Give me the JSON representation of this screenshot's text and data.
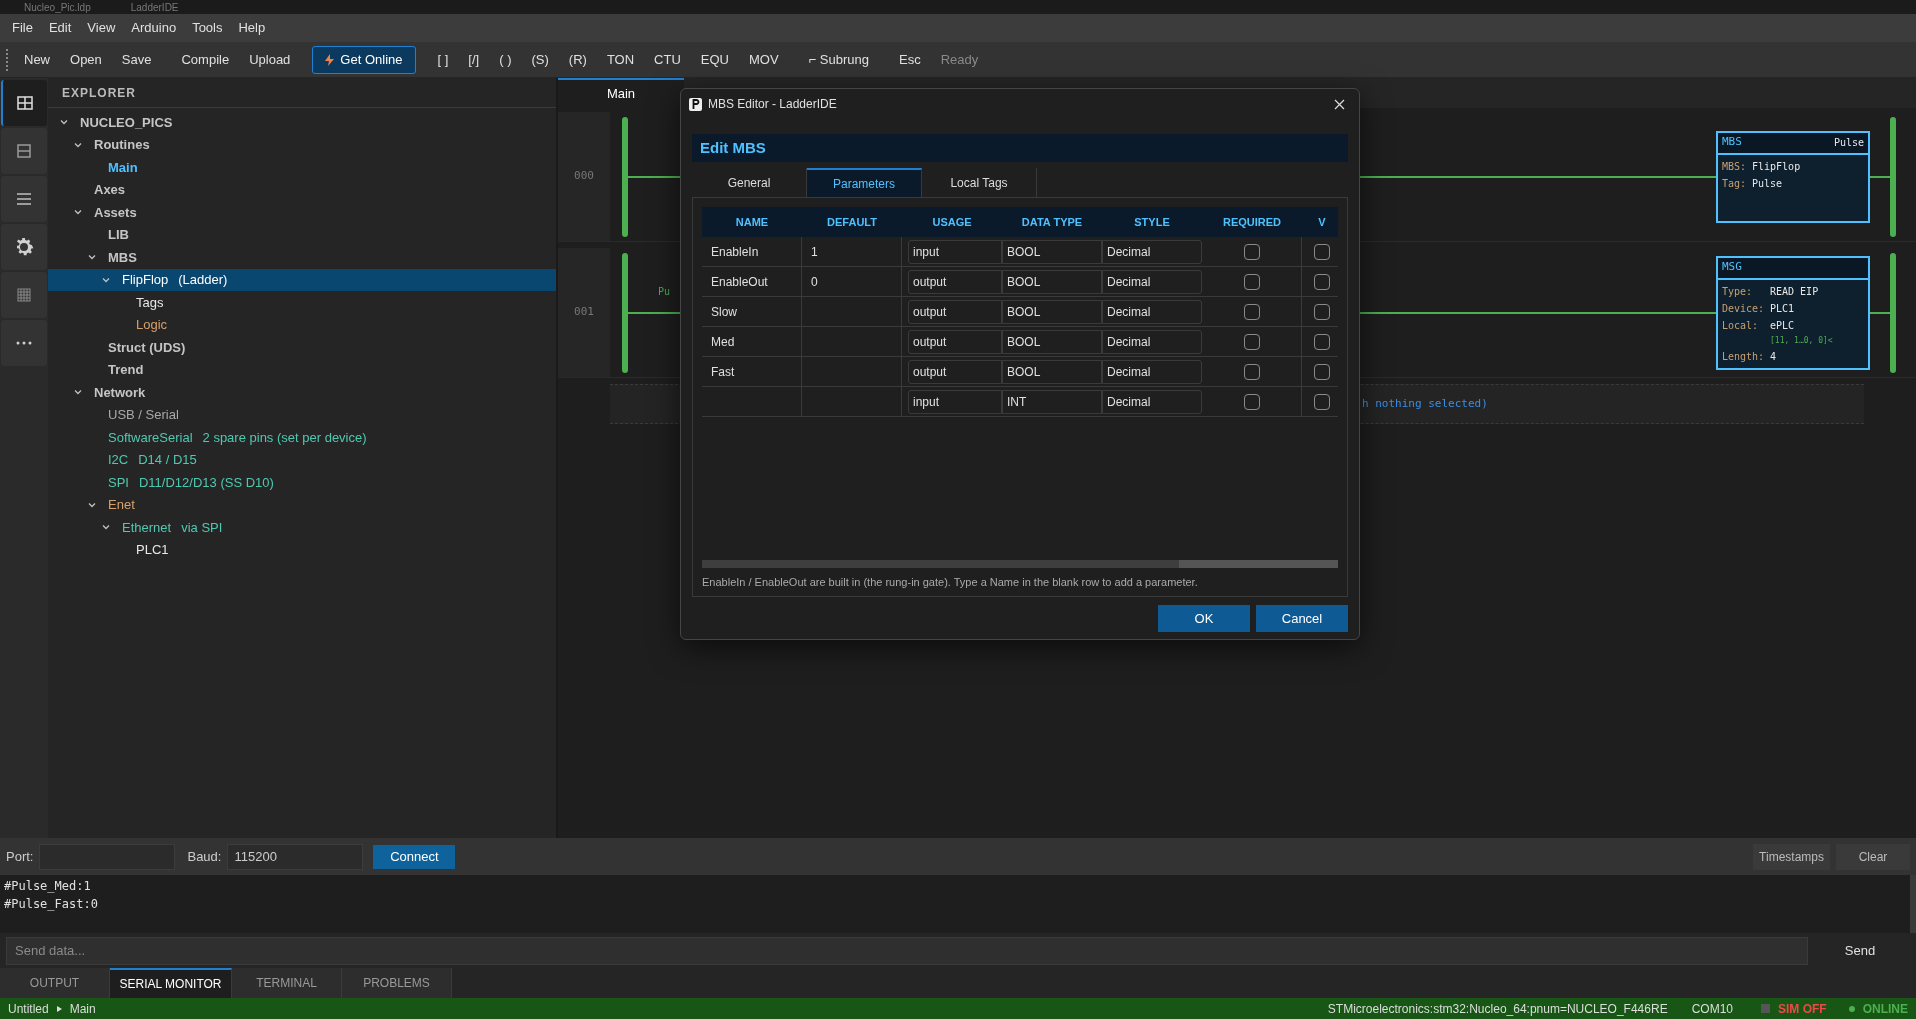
{
  "window": {
    "title": "Nucleo_Pic.ldp",
    "app": "LadderIDE"
  },
  "menu": [
    "File",
    "Edit",
    "View",
    "Arduino",
    "Tools",
    "Help"
  ],
  "toolbar": [
    [
      {
        "label": "New",
        "kind": "button"
      },
      {
        "label": "Open",
        "kind": "button"
      },
      {
        "label": "Save",
        "kind": "button"
      }
    ],
    [
      {
        "label": "Compile",
        "kind": "button"
      },
      {
        "label": "Upload",
        "kind": "button"
      }
    ],
    [
      {
        "label": "Get Online",
        "kind": "primary"
      }
    ],
    [
      {
        "label": "[ ]",
        "kind": "button"
      },
      {
        "label": "[/]",
        "kind": "button"
      },
      {
        "label": "( )",
        "kind": "button"
      },
      {
        "label": "(S)",
        "kind": "button"
      },
      {
        "label": "(R)",
        "kind": "button"
      },
      {
        "label": "TON",
        "kind": "button"
      },
      {
        "label": "CTU",
        "kind": "button"
      },
      {
        "label": "EQU",
        "kind": "button"
      },
      {
        "label": "MOV",
        "kind": "button"
      }
    ],
    [
      {
        "label": "⌐ Subrung",
        "kind": "button"
      }
    ],
    [
      {
        "label": "Esc",
        "kind": "button"
      },
      {
        "label": "Ready",
        "kind": "status"
      }
    ]
  ],
  "activity_bar": [
    {
      "kind": "explorer",
      "selected": true
    },
    {
      "kind": "panel",
      "selected": false
    },
    {
      "kind": "list",
      "selected": false
    },
    {
      "kind": "settings",
      "selected": false
    },
    {
      "kind": "table",
      "selected": false
    },
    {
      "kind": "more",
      "selected": false
    }
  ],
  "explorer": {
    "title": "EXPLORER",
    "tree": [
      {
        "label": "NUCLEO_PICS",
        "kind": "group",
        "color": "#c5c5c5",
        "selected": false,
        "expanded": true,
        "children": [
          {
            "label": "Routines",
            "kind": "group",
            "color": "#c5c5c5",
            "selected": false,
            "expanded": true,
            "children": [
              {
                "label": "Main",
                "kind": "group",
                "color": "#4fc1ff",
                "selected": false
              }
            ]
          },
          {
            "label": "Axes",
            "kind": "group",
            "color": "#c5c5c5",
            "selected": false
          },
          {
            "label": "Assets",
            "kind": "group",
            "color": "#c5c5c5",
            "selected": false,
            "expanded": true,
            "children": [
              {
                "label": "LIB",
                "kind": "group",
                "color": "#c5c5c5",
                "selected": false
              },
              {
                "label": "MBS",
                "kind": "group",
                "color": "#c5c5c5",
                "selected": false,
                "expanded": true,
                "children": [
                  {
                    "label": "FlipFlop",
                    "detail": "(Ladder)",
                    "kind": "item",
                    "selected": true,
                    "expanded": true,
                    "children": [
                      {
                        "label": "Tags",
                        "kind": "item",
                        "color": "#e8e8e8",
                        "selected": false
                      },
                      {
                        "label": "Logic",
                        "kind": "item",
                        "color": "#d7a06a",
                        "selected": false
                      }
                    ]
                  }
                ]
              },
              {
                "label": "Struct (UDS)",
                "kind": "group",
                "color": "#c5c5c5",
                "selected": false
              },
              {
                "label": "Trend",
                "kind": "group",
                "color": "#c5c5c5",
                "selected": false
              }
            ]
          },
          {
            "label": "Network",
            "kind": "group",
            "color": "#c5c5c5",
            "selected": false,
            "expanded": true,
            "children": [
              {
                "label": "USB / Serial",
                "kind": "item",
                "color": "#a8a8a8",
                "selected": false
              },
              {
                "label": "SoftwareSerial",
                "detail": "2 spare pins (set per device)",
                "kind": "item",
                "color": "#4ec9b0",
                "selected": false
              },
              {
                "label": "I2C",
                "detail": "D14 / D15",
                "kind": "item",
                "color": "#4ec9b0",
                "selected": false
              },
              {
                "label": "SPI",
                "detail": "D11/D12/D13 (SS D10)",
                "kind": "item",
                "color": "#4ec9b0",
                "selected": false
              },
              {
                "label": "Enet",
                "kind": "item",
                "color": "#d7a06a",
                "selected": false,
                "expanded": true,
                "children": [
                  {
                    "label": "Ethernet",
                    "detail": "via SPI",
                    "kind": "item",
                    "color": "#4ec9b0",
                    "selected": false,
                    "expanded": true,
                    "children": [
                      {
                        "label": "PLC1",
                        "kind": "item",
                        "color": "#e8e8e8",
                        "selected": false
                      }
                    ]
                  }
                ]
              }
            ]
          }
        ]
      }
    ]
  },
  "editor": {
    "tabs": [
      {
        "label": "Main",
        "selected": true
      }
    ],
    "rungs": [
      {
        "number": "000",
        "block": {
          "name": "MBS",
          "tag": "Pulse",
          "lines": [
            {
              "label": "MBS:",
              "value": "FlipFlop"
            },
            {
              "label": "Tag:",
              "value": "Pulse"
            }
          ]
        }
      },
      {
        "number": "001",
        "contact_label": "Pu",
        "block": {
          "name": "MSG",
          "lines": [
            {
              "label": "Type:",
              "value": "READ EIP"
            },
            {
              "label": "Device:",
              "value": "PLC1"
            },
            {
              "label": "Local:",
              "value": "ePLC"
            },
            {
              "value": "[11, 1…0, 0]<",
              "kind": "note"
            },
            {
              "label": "Length:",
              "value": "4"
            }
          ]
        }
      }
    ],
    "drop_hint": "h nothing selected)"
  },
  "dialog": {
    "title": "MBS Editor - LadderIDE",
    "heading": "Edit MBS",
    "tabs": [
      {
        "label": "General",
        "selected": false
      },
      {
        "label": "Parameters",
        "selected": true
      },
      {
        "label": "Local Tags",
        "selected": false
      }
    ],
    "table": {
      "columns": [
        "NAME",
        "DEFAULT",
        "USAGE",
        "DATA TYPE",
        "STYLE",
        "REQUIRED",
        "V"
      ],
      "rows": [
        {
          "name": "EnableIn",
          "default": "1",
          "usage": "input",
          "data_type": "BOOL",
          "style": "Decimal",
          "required": false,
          "visible": false
        },
        {
          "name": "EnableOut",
          "default": "0",
          "usage": "output",
          "data_type": "BOOL",
          "style": "Decimal",
          "required": false,
          "visible": false
        },
        {
          "name": "Slow",
          "default": "",
          "usage": "output",
          "data_type": "BOOL",
          "style": "Decimal",
          "required": false,
          "visible": false
        },
        {
          "name": "Med",
          "default": "",
          "usage": "output",
          "data_type": "BOOL",
          "style": "Decimal",
          "required": false,
          "visible": false
        },
        {
          "name": "Fast",
          "default": "",
          "usage": "output",
          "data_type": "BOOL",
          "style": "Decimal",
          "required": false,
          "visible": false
        },
        {
          "name": "",
          "default": "",
          "usage": "input",
          "data_type": "INT",
          "style": "Decimal",
          "required": false,
          "visible": false
        }
      ]
    },
    "note": "EnableIn / EnableOut are built in (the rung-in gate). Type a Name in the blank row to add a parameter.",
    "buttons": [
      "OK",
      "Cancel"
    ]
  },
  "serial": {
    "port_label": "Port:",
    "baud_label": "Baud:",
    "baud": "115200",
    "connect": "Connect",
    "timestamps": "Timestamps",
    "clear": "Clear",
    "output": [
      "#Pulse_Med:1",
      "#Pulse_Fast:0"
    ],
    "send_placeholder": "Send data...",
    "send": "Send"
  },
  "panel_tabs": [
    {
      "label": "OUTPUT",
      "selected": false
    },
    {
      "label": "SERIAL MONITOR",
      "selected": true
    },
    {
      "label": "TERMINAL",
      "selected": false
    },
    {
      "label": "PROBLEMS",
      "selected": false
    }
  ],
  "status_bar": {
    "file": "Untitled",
    "routine": "Main",
    "board": "STMicroelectronics:stm32:Nucleo_64:pnum=NUCLEO_F446RE",
    "port": "COM10",
    "sim": "SIM OFF",
    "sim_on": false,
    "connection": "ONLINE",
    "online": true
  }
}
